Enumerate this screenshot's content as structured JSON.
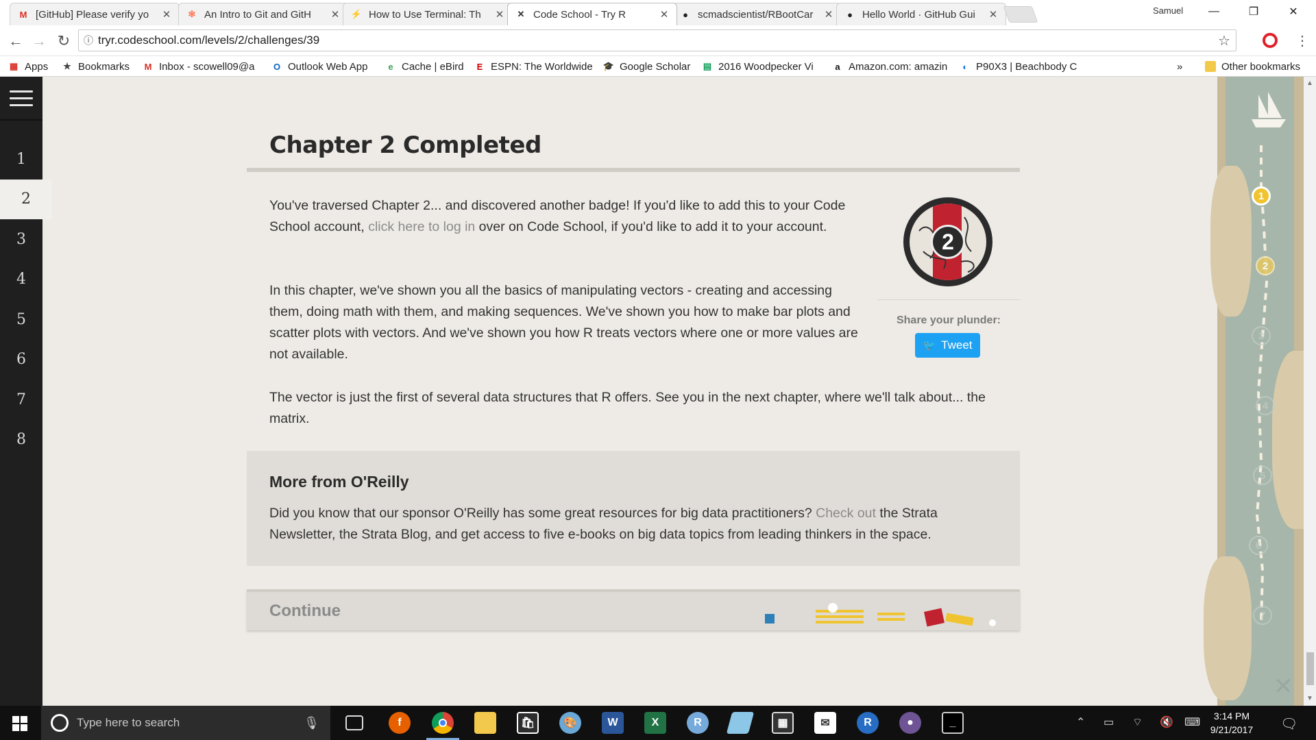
{
  "browser": {
    "tabs": [
      {
        "title": "[GitHub] Please verify yo",
        "icon": "gmail-icon",
        "glyph": "M",
        "color": "#d93025"
      },
      {
        "title": "An Intro to Git and GitH",
        "icon": "hubspot-icon",
        "glyph": "✻",
        "color": "#ff7a59"
      },
      {
        "title": "How to Use Terminal: Th",
        "icon": "bolt-icon",
        "glyph": "⚡",
        "color": "#1e73e8"
      },
      {
        "title": "Code School - Try R",
        "icon": "crossed-tools-icon",
        "glyph": "✕",
        "color": "#333333"
      },
      {
        "title": "scmadscientist/RBootCar",
        "icon": "github-icon",
        "glyph": "●",
        "color": "#222222"
      },
      {
        "title": "Hello World · GitHub Gui",
        "icon": "github-icon",
        "glyph": "●",
        "color": "#222222"
      }
    ],
    "profile_name": "Samuel",
    "url": "tryr.codeschool.com/levels/2/challenges/39",
    "bookmarks": [
      {
        "label": "Apps",
        "icon": "apps-grid-icon",
        "glyph": "▦",
        "color": "#d93025"
      },
      {
        "label": "Bookmarks",
        "icon": "star-icon",
        "glyph": "★",
        "color": "#444444"
      },
      {
        "label": "Inbox - scowell09@a",
        "icon": "gmail-icon",
        "glyph": "M",
        "color": "#d93025"
      },
      {
        "label": "Outlook Web App",
        "icon": "outlook-icon",
        "glyph": "O",
        "color": "#0a64c7"
      },
      {
        "label": "Cache | eBird",
        "icon": "ebird-icon",
        "glyph": "e",
        "color": "#3aa35b"
      },
      {
        "label": "ESPN: The Worldwide",
        "icon": "espn-icon",
        "glyph": "E",
        "color": "#d00000"
      },
      {
        "label": "Google Scholar",
        "icon": "scholar-icon",
        "glyph": "🎓",
        "color": "#4285f4"
      },
      {
        "label": "2016 Woodpecker Vi",
        "icon": "sheets-icon",
        "glyph": "▤",
        "color": "#0f9d58"
      },
      {
        "label": "Amazon.com: amazin",
        "icon": "amazon-icon",
        "glyph": "a",
        "color": "#111111"
      },
      {
        "label": "P90X3 | Beachbody C",
        "icon": "beachbody-icon",
        "glyph": "◐",
        "color": "#1a73e8"
      }
    ],
    "overflow_label": "»",
    "other_bookmarks": "Other bookmarks"
  },
  "sidebar": {
    "chapters": [
      "1",
      "2",
      "3",
      "4",
      "5",
      "6",
      "7",
      "8"
    ],
    "active_chapter": "2"
  },
  "main": {
    "title": "Chapter 2 Completed",
    "para1_before": "You've traversed Chapter 2... and discovered another badge! If you'd like to add this to your Code School account, ",
    "para1_link": "click here to log in",
    "para1_after": " over on Code School, if you'd like to add it to your account.",
    "para2": "In this chapter, we've shown you all the basics of manipulating vectors - creating and accessing them, doing math with them, and making sequences. We've shown you how to make bar plots and scatter plots with vectors. And we've shown you how R treats vectors where one or more values are not available.",
    "para3": "The vector is just the first of several data structures that R offers. See you in the next chapter, where we'll talk about... the matrix.",
    "badge_number": "2",
    "share_label": "Share your plunder:",
    "tweet_label": "Tweet",
    "oreilly": {
      "title": "More from O'Reilly",
      "text_before": "Did you know that our sponsor O'Reilly has some great resources for big data practitioners? ",
      "link": "Check out",
      "text_after": " the Strata Newsletter, the Strata Blog, and get access to five e-books on big data topics from leading thinkers in the space."
    },
    "continue_label": "Continue"
  },
  "map": {
    "nodes": [
      {
        "label": "1",
        "state": "done"
      },
      {
        "label": "2",
        "state": "next"
      },
      {
        "label": "3",
        "state": "locked"
      },
      {
        "label": "4",
        "state": "locked"
      },
      {
        "label": "5",
        "state": "locked"
      },
      {
        "label": "6",
        "state": "locked"
      },
      {
        "label": "7",
        "state": "locked"
      }
    ],
    "close_glyph": "✕"
  },
  "taskbar": {
    "search_placeholder": "Type here to search",
    "time": "3:14 PM",
    "date": "9/21/2017"
  },
  "colors": {
    "link": "#8b8b8b",
    "tweet": "#1da1f2",
    "badge_red": "#c0232f",
    "map_gold": "#f0c430"
  }
}
